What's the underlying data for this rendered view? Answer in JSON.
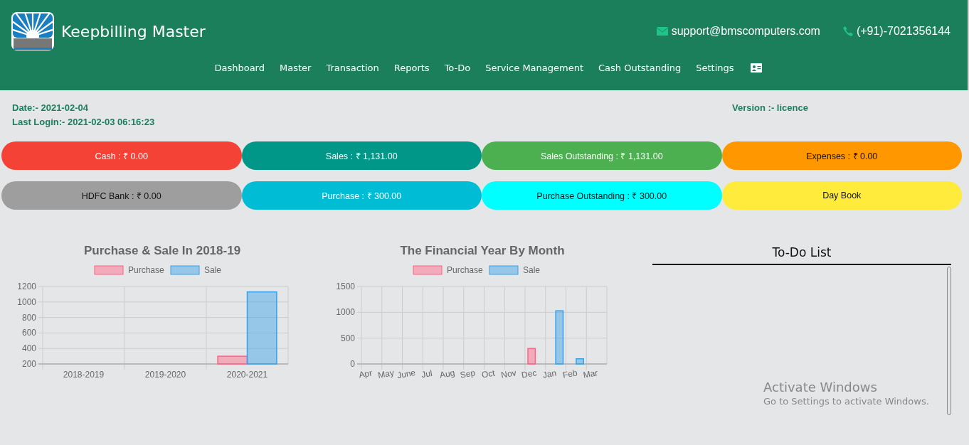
{
  "header": {
    "brand": "Keepbilling Master",
    "email": "support@bmscomputers.com",
    "phone": "(+91)-7021356144"
  },
  "nav": [
    {
      "label": "Dashboard"
    },
    {
      "label": "Master"
    },
    {
      "label": "Transaction"
    },
    {
      "label": "Reports"
    },
    {
      "label": "To-Do"
    },
    {
      "label": "Service Management"
    },
    {
      "label": "Cash Outstanding"
    },
    {
      "label": "Settings"
    }
  ],
  "info": {
    "date": "Date:- 2021-02-04",
    "last_login": "Last Login:- 2021-02-03 06:16:23",
    "version": "Version :- licence"
  },
  "tiles": [
    {
      "label": "Cash : ₹ 0.00",
      "color": "#f44336"
    },
    {
      "label": "Sales : ₹ 1,131.00",
      "color": "#009688"
    },
    {
      "label": "Sales Outstanding : ₹ 1,131.00",
      "color": "#4caf50"
    },
    {
      "label": "Expenses : ₹ 0.00",
      "color": "#ff9800"
    },
    {
      "label": "HDFC Bank : ₹ 0.00",
      "color": "#9e9e9e"
    },
    {
      "label": "Purchase : ₹ 300.00",
      "color": "#00bcd4"
    },
    {
      "label": "Purchase Outstanding : ₹ 300.00",
      "color": "#00ffff"
    },
    {
      "label": "Day Book",
      "color": "#ffeb3b"
    }
  ],
  "charts": [
    {
      "chart_data": {
        "type": "bar",
        "title": "Purchase & Sale In 2018-19",
        "categories": [
          "2018-2019",
          "2019-2020",
          "2020-2021"
        ],
        "series": [
          {
            "name": "Purchase",
            "color": "#ff6384",
            "values": [
              null,
              null,
              300
            ]
          },
          {
            "name": "Sale",
            "color": "#36a2eb",
            "values": [
              null,
              null,
              1130
            ]
          }
        ],
        "legend": true,
        "grid": true,
        "ylim": [
          200,
          1200
        ],
        "yticks": [
          200,
          400,
          600,
          800,
          1000,
          1200
        ]
      }
    },
    {
      "chart_data": {
        "type": "bar",
        "title": "The Financial Year By Month",
        "categories": [
          "Apr",
          "May",
          "June",
          "Jul",
          "Aug",
          "Sep",
          "Oct",
          "Nov",
          "Dec",
          "Jan",
          "Feb",
          "Mar"
        ],
        "series": [
          {
            "name": "Purchase",
            "color": "#ff6384",
            "values": [
              null,
              null,
              null,
              null,
              null,
              null,
              null,
              null,
              300,
              null,
              null,
              null
            ]
          },
          {
            "name": "Sale",
            "color": "#36a2eb",
            "values": [
              null,
              null,
              null,
              null,
              null,
              null,
              null,
              null,
              null,
              1030,
              100,
              null
            ]
          }
        ],
        "legend": true,
        "grid": true,
        "ylim": [
          0,
          1500
        ],
        "yticks": [
          0,
          500,
          1000,
          1500
        ]
      }
    }
  ],
  "todo": {
    "title": "To-Do List"
  },
  "os_notice": {
    "title": "Activate Windows",
    "subtitle": "Go to Settings to activate Windows."
  }
}
